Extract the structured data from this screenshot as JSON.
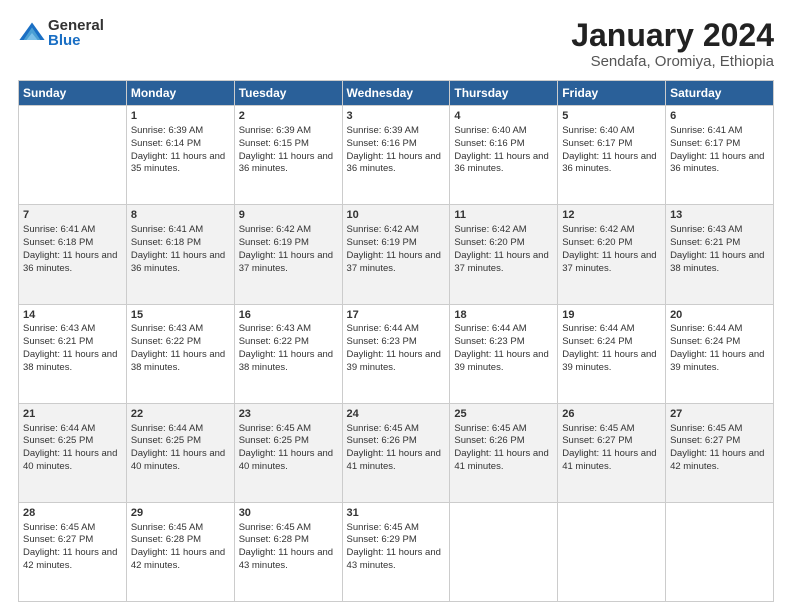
{
  "logo": {
    "general": "General",
    "blue": "Blue"
  },
  "title": "January 2024",
  "subtitle": "Sendafa, Oromiya, Ethiopia",
  "weekdays": [
    "Sunday",
    "Monday",
    "Tuesday",
    "Wednesday",
    "Thursday",
    "Friday",
    "Saturday"
  ],
  "weeks": [
    [
      {
        "day": "",
        "sunrise": "",
        "sunset": "",
        "daylight": ""
      },
      {
        "day": "1",
        "sunrise": "Sunrise: 6:39 AM",
        "sunset": "Sunset: 6:14 PM",
        "daylight": "Daylight: 11 hours and 35 minutes."
      },
      {
        "day": "2",
        "sunrise": "Sunrise: 6:39 AM",
        "sunset": "Sunset: 6:15 PM",
        "daylight": "Daylight: 11 hours and 36 minutes."
      },
      {
        "day": "3",
        "sunrise": "Sunrise: 6:39 AM",
        "sunset": "Sunset: 6:16 PM",
        "daylight": "Daylight: 11 hours and 36 minutes."
      },
      {
        "day": "4",
        "sunrise": "Sunrise: 6:40 AM",
        "sunset": "Sunset: 6:16 PM",
        "daylight": "Daylight: 11 hours and 36 minutes."
      },
      {
        "day": "5",
        "sunrise": "Sunrise: 6:40 AM",
        "sunset": "Sunset: 6:17 PM",
        "daylight": "Daylight: 11 hours and 36 minutes."
      },
      {
        "day": "6",
        "sunrise": "Sunrise: 6:41 AM",
        "sunset": "Sunset: 6:17 PM",
        "daylight": "Daylight: 11 hours and 36 minutes."
      }
    ],
    [
      {
        "day": "7",
        "sunrise": "Sunrise: 6:41 AM",
        "sunset": "Sunset: 6:18 PM",
        "daylight": "Daylight: 11 hours and 36 minutes."
      },
      {
        "day": "8",
        "sunrise": "Sunrise: 6:41 AM",
        "sunset": "Sunset: 6:18 PM",
        "daylight": "Daylight: 11 hours and 36 minutes."
      },
      {
        "day": "9",
        "sunrise": "Sunrise: 6:42 AM",
        "sunset": "Sunset: 6:19 PM",
        "daylight": "Daylight: 11 hours and 37 minutes."
      },
      {
        "day": "10",
        "sunrise": "Sunrise: 6:42 AM",
        "sunset": "Sunset: 6:19 PM",
        "daylight": "Daylight: 11 hours and 37 minutes."
      },
      {
        "day": "11",
        "sunrise": "Sunrise: 6:42 AM",
        "sunset": "Sunset: 6:20 PM",
        "daylight": "Daylight: 11 hours and 37 minutes."
      },
      {
        "day": "12",
        "sunrise": "Sunrise: 6:42 AM",
        "sunset": "Sunset: 6:20 PM",
        "daylight": "Daylight: 11 hours and 37 minutes."
      },
      {
        "day": "13",
        "sunrise": "Sunrise: 6:43 AM",
        "sunset": "Sunset: 6:21 PM",
        "daylight": "Daylight: 11 hours and 38 minutes."
      }
    ],
    [
      {
        "day": "14",
        "sunrise": "Sunrise: 6:43 AM",
        "sunset": "Sunset: 6:21 PM",
        "daylight": "Daylight: 11 hours and 38 minutes."
      },
      {
        "day": "15",
        "sunrise": "Sunrise: 6:43 AM",
        "sunset": "Sunset: 6:22 PM",
        "daylight": "Daylight: 11 hours and 38 minutes."
      },
      {
        "day": "16",
        "sunrise": "Sunrise: 6:43 AM",
        "sunset": "Sunset: 6:22 PM",
        "daylight": "Daylight: 11 hours and 38 minutes."
      },
      {
        "day": "17",
        "sunrise": "Sunrise: 6:44 AM",
        "sunset": "Sunset: 6:23 PM",
        "daylight": "Daylight: 11 hours and 39 minutes."
      },
      {
        "day": "18",
        "sunrise": "Sunrise: 6:44 AM",
        "sunset": "Sunset: 6:23 PM",
        "daylight": "Daylight: 11 hours and 39 minutes."
      },
      {
        "day": "19",
        "sunrise": "Sunrise: 6:44 AM",
        "sunset": "Sunset: 6:24 PM",
        "daylight": "Daylight: 11 hours and 39 minutes."
      },
      {
        "day": "20",
        "sunrise": "Sunrise: 6:44 AM",
        "sunset": "Sunset: 6:24 PM",
        "daylight": "Daylight: 11 hours and 39 minutes."
      }
    ],
    [
      {
        "day": "21",
        "sunrise": "Sunrise: 6:44 AM",
        "sunset": "Sunset: 6:25 PM",
        "daylight": "Daylight: 11 hours and 40 minutes."
      },
      {
        "day": "22",
        "sunrise": "Sunrise: 6:44 AM",
        "sunset": "Sunset: 6:25 PM",
        "daylight": "Daylight: 11 hours and 40 minutes."
      },
      {
        "day": "23",
        "sunrise": "Sunrise: 6:45 AM",
        "sunset": "Sunset: 6:25 PM",
        "daylight": "Daylight: 11 hours and 40 minutes."
      },
      {
        "day": "24",
        "sunrise": "Sunrise: 6:45 AM",
        "sunset": "Sunset: 6:26 PM",
        "daylight": "Daylight: 11 hours and 41 minutes."
      },
      {
        "day": "25",
        "sunrise": "Sunrise: 6:45 AM",
        "sunset": "Sunset: 6:26 PM",
        "daylight": "Daylight: 11 hours and 41 minutes."
      },
      {
        "day": "26",
        "sunrise": "Sunrise: 6:45 AM",
        "sunset": "Sunset: 6:27 PM",
        "daylight": "Daylight: 11 hours and 41 minutes."
      },
      {
        "day": "27",
        "sunrise": "Sunrise: 6:45 AM",
        "sunset": "Sunset: 6:27 PM",
        "daylight": "Daylight: 11 hours and 42 minutes."
      }
    ],
    [
      {
        "day": "28",
        "sunrise": "Sunrise: 6:45 AM",
        "sunset": "Sunset: 6:27 PM",
        "daylight": "Daylight: 11 hours and 42 minutes."
      },
      {
        "day": "29",
        "sunrise": "Sunrise: 6:45 AM",
        "sunset": "Sunset: 6:28 PM",
        "daylight": "Daylight: 11 hours and 42 minutes."
      },
      {
        "day": "30",
        "sunrise": "Sunrise: 6:45 AM",
        "sunset": "Sunset: 6:28 PM",
        "daylight": "Daylight: 11 hours and 43 minutes."
      },
      {
        "day": "31",
        "sunrise": "Sunrise: 6:45 AM",
        "sunset": "Sunset: 6:29 PM",
        "daylight": "Daylight: 11 hours and 43 minutes."
      },
      {
        "day": "",
        "sunrise": "",
        "sunset": "",
        "daylight": ""
      },
      {
        "day": "",
        "sunrise": "",
        "sunset": "",
        "daylight": ""
      },
      {
        "day": "",
        "sunrise": "",
        "sunset": "",
        "daylight": ""
      }
    ]
  ]
}
